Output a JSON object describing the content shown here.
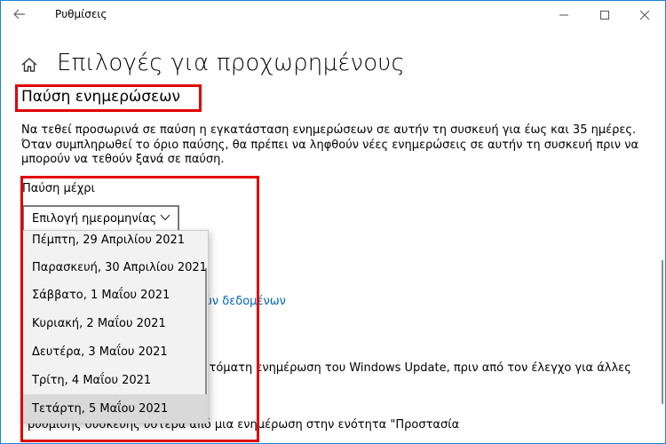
{
  "window": {
    "title": "Ρυθμίσεις"
  },
  "page": {
    "title": "Επιλογές για προχωρημένους"
  },
  "section": {
    "title": "Παύση ενημερώσεων",
    "description": "Να τεθεί προσωρινά σε παύση η εγκατάσταση ενημερώσεων σε αυτήν τη συσκευή για έως και 35 ημέρες. Όταν συμπληρωθεί το όριο παύσης, θα πρέπει να ληφθούν νέες ενημερώσεις σε αυτήν τη συσκευή πριν να μπορούν να τεθούν ξανά σε παύση.",
    "pause_label": "Παύση μέχρι",
    "select_value": "Επιλογή ημερομηνίας"
  },
  "dropdown": {
    "items": [
      "Πέμπτη, 29 Απριλίου 2021",
      "Παρασκευή, 30 Απριλίου 2021",
      "Σάββατο, 1 Μαΐου 2021",
      "Κυριακή, 2 Μαΐου 2021",
      "Δευτέρα, 3 Μαΐου 2021",
      "Τρίτη, 4 Μαΐου 2021",
      "Τετάρτη, 5 Μαΐου 2021"
    ],
    "selected_index": 6
  },
  "background": {
    "link_fragment": "ών δεδομένων",
    "text_fragment_1": "υτόματη ενημέρωση του Windows Update, πριν από τον έλεγχο για άλλες",
    "text_fragment_2": "ρυθμίσης συσκευής ύστερα από μια ενημέρωση στην ενότητα \"Προστασία"
  },
  "colors": {
    "accent": "#0067b8",
    "highlight_box": "#e00000",
    "window_border": "#1883d7"
  }
}
